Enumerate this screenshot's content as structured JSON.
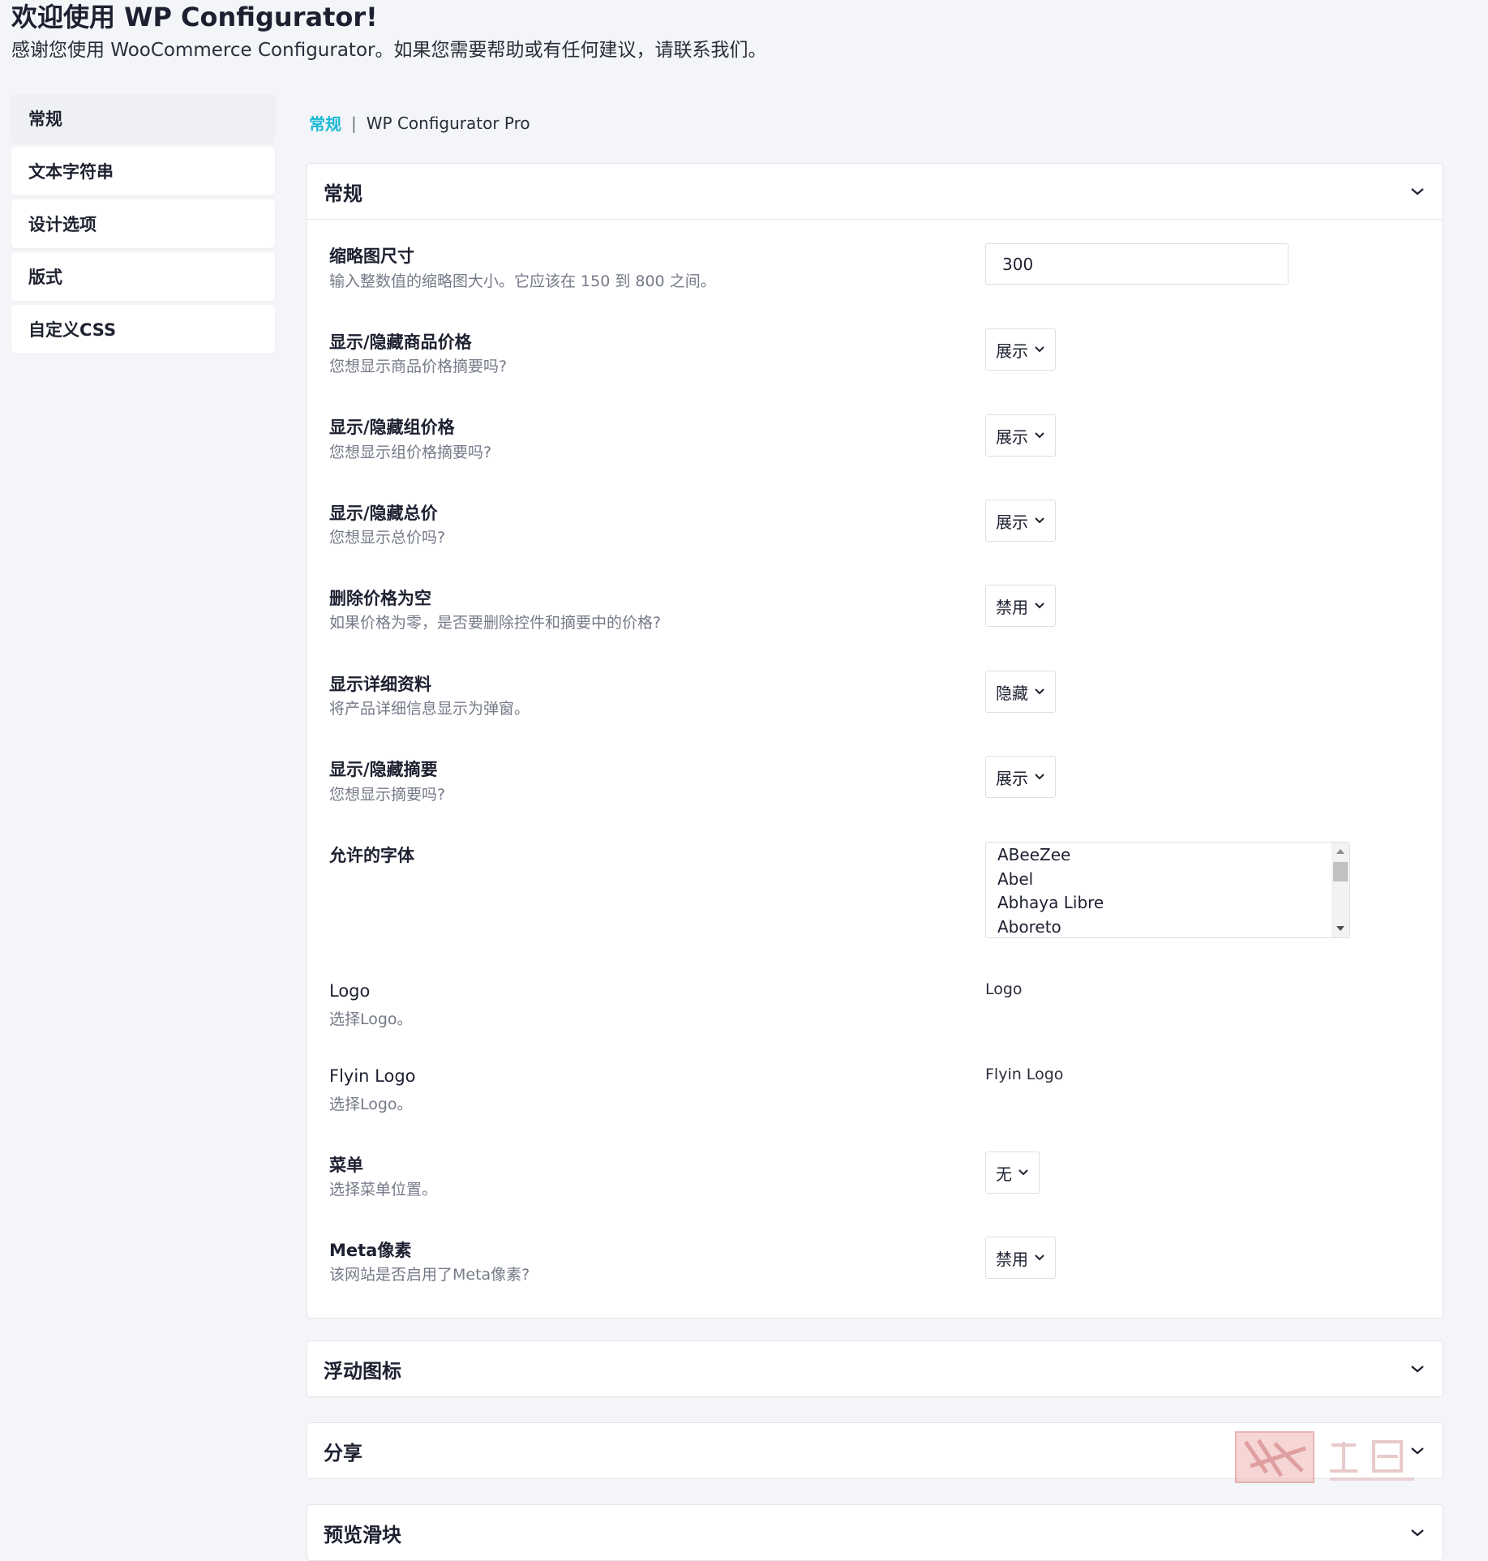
{
  "header": {
    "title": "欢迎使用 WP Configurator!",
    "subtitle": "感谢您使用 WooCommerce Configurator。如果您需要帮助或有任何建议，请联系我们。"
  },
  "sidebar": {
    "items": [
      {
        "label": "常规"
      },
      {
        "label": "文本字符串"
      },
      {
        "label": "设计选项"
      },
      {
        "label": "版式"
      },
      {
        "label": "自定义CSS"
      }
    ]
  },
  "breadcrumb": {
    "active": "常规",
    "separator": "|",
    "product": "WP Configurator Pro"
  },
  "colors": {
    "accent": "#1cb8d6",
    "background": "#f4f5f8",
    "panel": "#ffffff",
    "muted_text": "#757a88"
  },
  "general_panel": {
    "title": "常规",
    "fields": {
      "thumbnail_size": {
        "label": "缩略图尺寸",
        "desc": "输入整数值的缩略图大小。它应该在 150 到 800 之间。",
        "value": "300"
      },
      "product_price": {
        "label": "显示/隐藏商品价格",
        "desc": "您想显示商品价格摘要吗?",
        "value": "展示"
      },
      "group_price": {
        "label": "显示/隐藏组价格",
        "desc": "您想显示组价格摘要吗?",
        "value": "展示"
      },
      "total_price": {
        "label": "显示/隐藏总价",
        "desc": "您想显示总价吗?",
        "value": "展示"
      },
      "remove_zero_price": {
        "label": "删除价格为空",
        "desc": "如果价格为零，是否要删除控件和摘要中的价格?",
        "value": "禁用"
      },
      "show_details": {
        "label": "显示详细资料",
        "desc": "将产品详细信息显示为弹窗。",
        "value": "隐藏"
      },
      "summary": {
        "label": "显示/隐藏摘要",
        "desc": "您想显示摘要吗?",
        "value": "展示"
      },
      "allowed_fonts": {
        "label": "允许的字体",
        "options": [
          "ABeeZee",
          "Abel",
          "Abhaya Libre",
          "Aboreto"
        ]
      },
      "logo": {
        "label": "Logo",
        "desc": "选择Logo。",
        "value": "Logo"
      },
      "flyin_logo": {
        "label": "Flyin Logo",
        "desc": "选择Logo。",
        "value": "Flyin Logo"
      },
      "menu": {
        "label": "菜单",
        "desc": "选择菜单位置。",
        "value": "无"
      },
      "meta_pixel": {
        "label": "Meta像素",
        "desc": "该网站是否启用了Meta像素?",
        "value": "禁用"
      }
    }
  },
  "collapsed_panels": [
    {
      "title": "浮动图标"
    },
    {
      "title": "分享"
    },
    {
      "title": "预览滑块"
    }
  ],
  "icons": {
    "panel_toggle": "chevron-down-icon",
    "select_toggle": "chevron-down-icon",
    "scroll_up": "triangle-up-icon",
    "scroll_down": "triangle-down-icon"
  }
}
